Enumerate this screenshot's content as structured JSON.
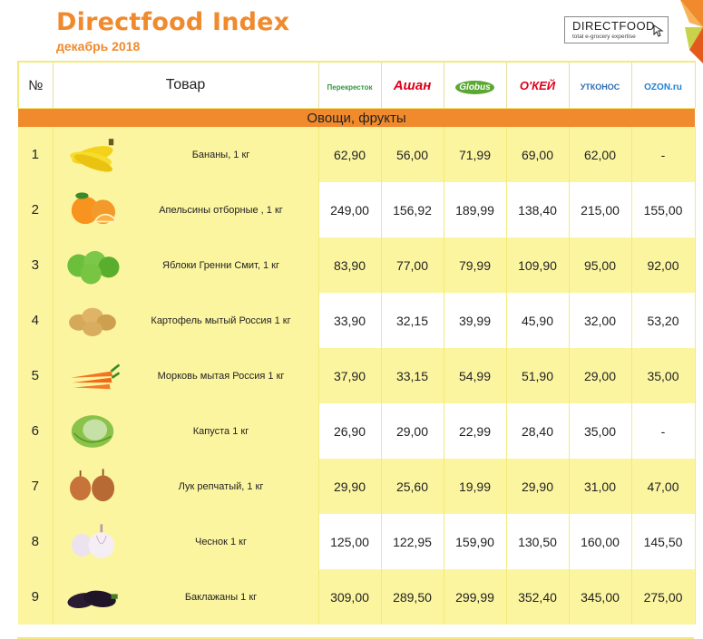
{
  "header": {
    "title": "Directfood Index",
    "subtitle": "декабрь 2018",
    "brand_name": "DIRECTFOOD",
    "brand_tagline": "total e-grocery expertise"
  },
  "table": {
    "col_num": "№",
    "col_product": "Товар",
    "stores": [
      "Перекресток",
      "Ашан",
      "Globus",
      "О'КЕЙ",
      "УТКОНОС",
      "OZON.ru"
    ],
    "category": "Овощи, фрукты",
    "rows": [
      {
        "num": "1",
        "name": "Бананы, 1 кг",
        "icon": "banana-icon",
        "prices": [
          "62,90",
          "56,00",
          "71,99",
          "69,00",
          "62,00",
          "-"
        ]
      },
      {
        "num": "2",
        "name": "Апельсины  отборные , 1 кг",
        "icon": "orange-icon",
        "prices": [
          "249,00",
          "156,92",
          "189,99",
          "138,40",
          "215,00",
          "155,00"
        ]
      },
      {
        "num": "3",
        "name": "Яблоки Гренни Смит, 1 кг",
        "icon": "apple-icon",
        "prices": [
          "83,90",
          "77,00",
          "79,99",
          "109,90",
          "95,00",
          "92,00"
        ]
      },
      {
        "num": "4",
        "name": "Картофель мытый Россия 1 кг",
        "icon": "potato-icon",
        "prices": [
          "33,90",
          "32,15",
          "39,99",
          "45,90",
          "32,00",
          "53,20"
        ]
      },
      {
        "num": "5",
        "name": "Морковь мытая Россия 1 кг",
        "icon": "carrot-icon",
        "prices": [
          "37,90",
          "33,15",
          "54,99",
          "51,90",
          "29,00",
          "35,00"
        ]
      },
      {
        "num": "6",
        "name": "Капуста 1 кг",
        "icon": "cabbage-icon",
        "prices": [
          "26,90",
          "29,00",
          "22,99",
          "28,40",
          "35,00",
          "-"
        ]
      },
      {
        "num": "7",
        "name": "Лук репчатый, 1 кг",
        "icon": "onion-icon",
        "prices": [
          "29,90",
          "25,60",
          "19,99",
          "29,90",
          "31,00",
          "47,00"
        ]
      },
      {
        "num": "8",
        "name": "Чеснок 1 кг",
        "icon": "garlic-icon",
        "prices": [
          "125,00",
          "122,95",
          "159,90",
          "130,50",
          "160,00",
          "145,50"
        ]
      },
      {
        "num": "9",
        "name": "Баклажаны 1 кг",
        "icon": "eggplant-icon",
        "prices": [
          "309,00",
          "289,50",
          "299,99",
          "352,40",
          "345,00",
          "275,00"
        ]
      }
    ]
  },
  "colors": {
    "accent": "#f08a2c",
    "highlight": "#fcf5a0"
  }
}
